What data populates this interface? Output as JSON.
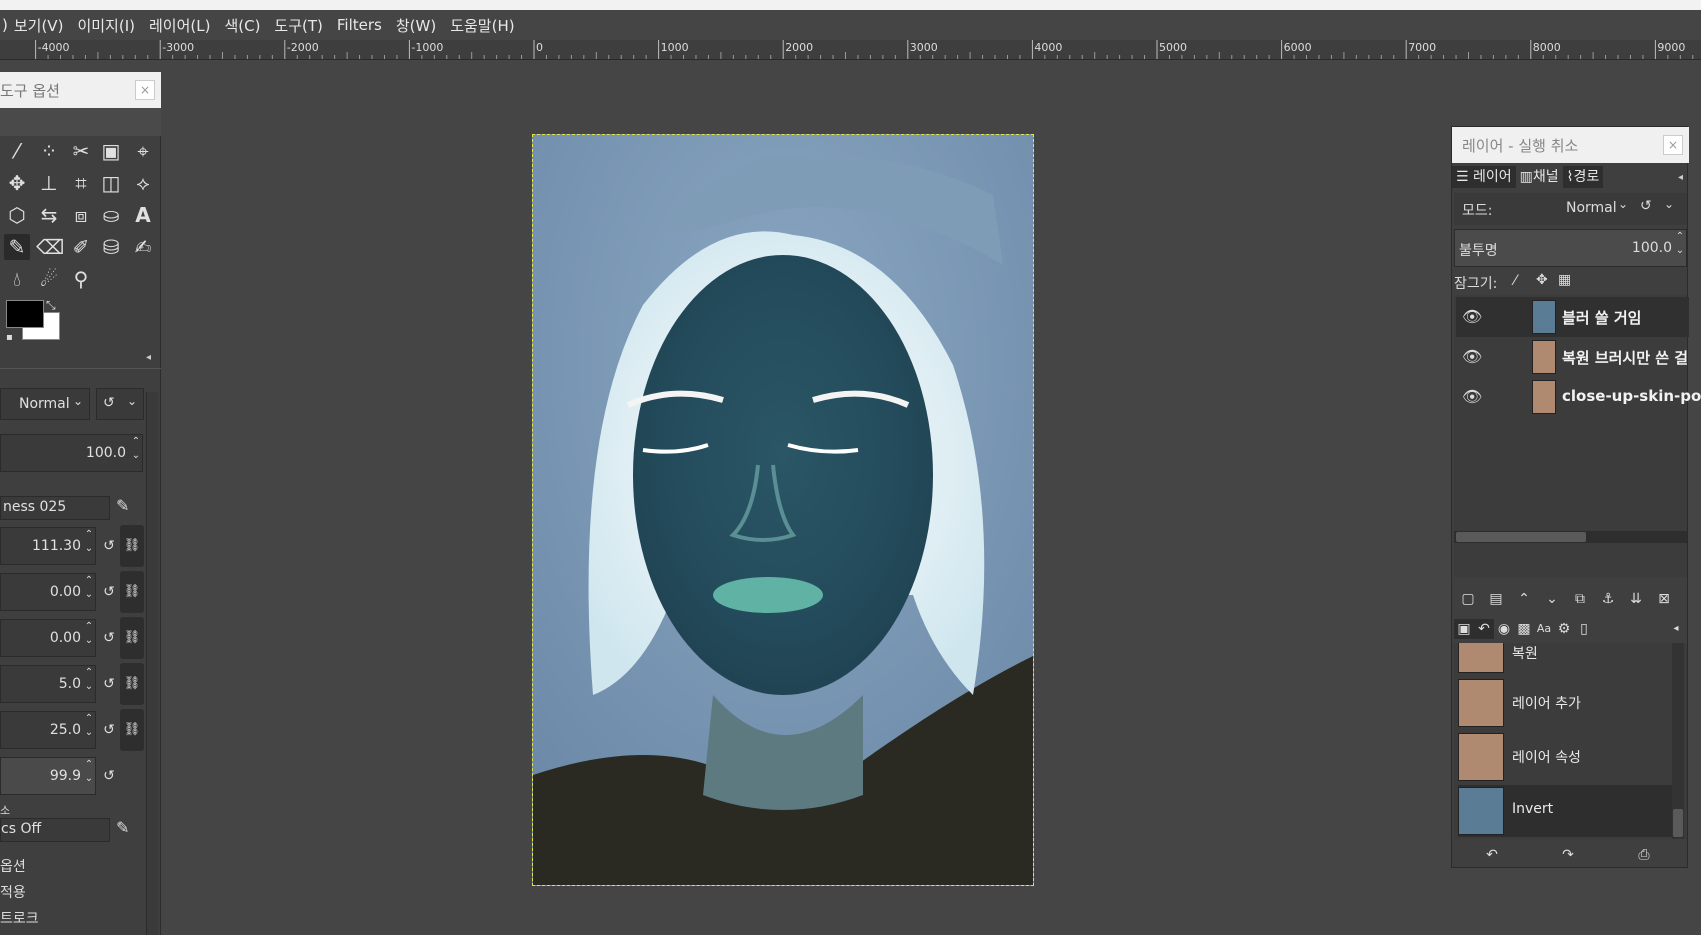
{
  "title_partial": "",
  "menu": [
    {
      "label": "보기(V)"
    },
    {
      "label": "이미지(I)"
    },
    {
      "label": "레이어(L)"
    },
    {
      "label": "색(C)"
    },
    {
      "label": "도구(T)"
    },
    {
      "label": "Filters"
    },
    {
      "label": "창(W)"
    },
    {
      "label": "도움말(H)"
    }
  ],
  "ruler": {
    "ticks": [
      "-4000",
      "-3000",
      "-2000",
      "-1000",
      "0",
      "1000",
      "2000",
      "3000",
      "4000",
      "5000",
      "6000",
      "7000",
      "8000",
      "9000"
    ]
  },
  "tool_options": {
    "title": "도구 옵션",
    "close": "×",
    "mode": "Normal",
    "opacity": "100.0",
    "brush": "ness 025",
    "values": [
      "111.30",
      "0.00",
      "0.00",
      "5.0",
      "25.0",
      "99.9"
    ],
    "dynamics": "cs Off",
    "extra_labels": [
      "옵션",
      "적용",
      "트로크"
    ],
    "small_label": "소"
  },
  "layers_panel": {
    "title": "레이어 - 실행 취소",
    "close": "×",
    "tabs": [
      {
        "label": "레이어"
      },
      {
        "label": "채널"
      },
      {
        "label": "경로"
      }
    ],
    "mode_label": "모드:",
    "mode_value": "Normal",
    "opacity_label": "불투명",
    "opacity_value": "100.0",
    "lock_label": "잠그기:",
    "layers": [
      {
        "name": "블러 쓸 거임",
        "thumb": "inverted"
      },
      {
        "name": "복원 브러시만 쓴 걸",
        "thumb": "normal"
      },
      {
        "name": "close-up-skin-pore",
        "thumb": "normal"
      }
    ]
  },
  "history": [
    {
      "name": "복원",
      "thumb": "normal"
    },
    {
      "name": "레이어 추가",
      "thumb": "normal"
    },
    {
      "name": "레이어 속성",
      "thumb": "normal"
    },
    {
      "name": "Invert",
      "thumb": "inverted"
    }
  ],
  "colors": {
    "fg": "#000000",
    "bg": "#ffffff",
    "canvas_border": "#e6e04a"
  }
}
